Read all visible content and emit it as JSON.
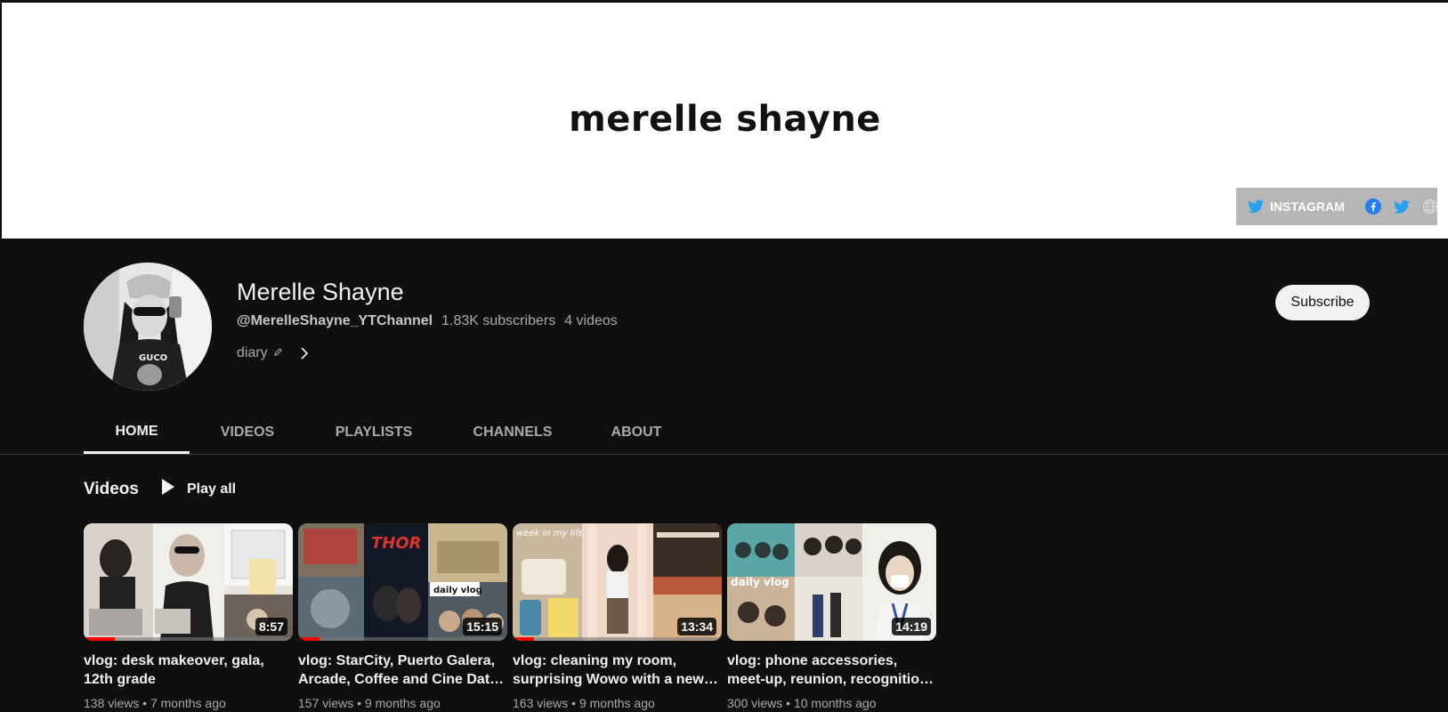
{
  "banner": {
    "title": "merelle shayne",
    "links": {
      "first_label": "INSTAGRAM",
      "icons": [
        "twitter-icon",
        "facebook-icon",
        "twitter-icon",
        "globe-icon"
      ]
    }
  },
  "channel": {
    "name": "Merelle Shayne",
    "handle": "@MerelleShayne_YTChannel",
    "subscribers": "1.83K subscribers",
    "video_count": "4 videos",
    "description": "diary",
    "subscribe_label": "Subscribe"
  },
  "tabs": [
    {
      "label": "HOME",
      "active": true
    },
    {
      "label": "VIDEOS",
      "active": false
    },
    {
      "label": "PLAYLISTS",
      "active": false
    },
    {
      "label": "CHANNELS",
      "active": false
    },
    {
      "label": "ABOUT",
      "active": false
    }
  ],
  "shelf": {
    "title": "Videos",
    "play_all": "Play all"
  },
  "videos": [
    {
      "title_line1": "vlog: desk makeover, gala,",
      "title_line2": "12th grade",
      "duration": "8:57",
      "views": "138 views",
      "age": "7 months ago",
      "watched": 0.15
    },
    {
      "title_line1": "vlog: StarCity, Puerto Galera,",
      "title_line2": "Arcade, Coffee and Cine Dat…",
      "duration": "15:15",
      "views": "157 views",
      "age": "9 months ago",
      "watched": 0.1
    },
    {
      "title_line1": "vlog: cleaning my room,",
      "title_line2": "surprising Wowo with a new…",
      "duration": "13:34",
      "views": "163 views",
      "age": "9 months ago",
      "watched": 0.1
    },
    {
      "title_line1": "vlog: phone accessories,",
      "title_line2": "meet-up, reunion, recognitio…",
      "duration": "14:19",
      "views": "300 views",
      "age": "10 months ago",
      "watched": 0
    }
  ],
  "thumb_text": {
    "daily_vlog": "daily vlog",
    "week_in_my_life": "week in my life"
  },
  "colors": {
    "background": "#0f0f0f",
    "accent": "#ff0000",
    "twitter": "#1d9bf0",
    "facebook": "#1877f2"
  }
}
